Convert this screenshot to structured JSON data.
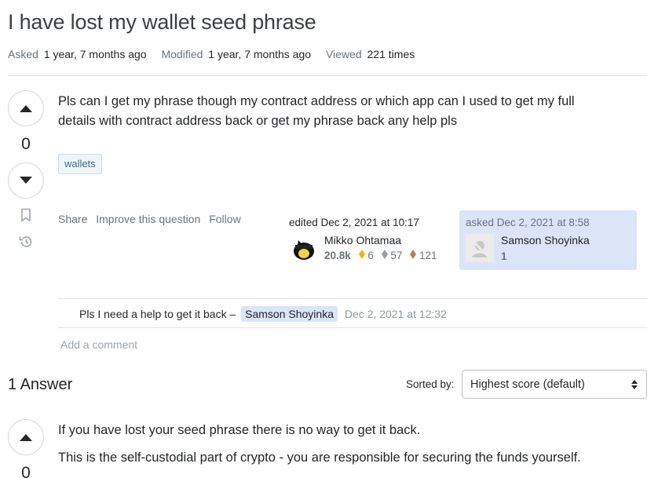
{
  "question": {
    "title": "I have lost my wallet seed phrase",
    "meta": {
      "asked_label": "Asked",
      "asked_value": "1 year, 7 months ago",
      "modified_label": "Modified",
      "modified_value": "1 year, 7 months ago",
      "viewed_label": "Viewed",
      "viewed_value": "221 times"
    },
    "score": "0",
    "body_line1": "Pls can I get my phrase though my contract address or which app can I used to get my full",
    "body_line2": "details with contract address back or get my phrase back any help pls",
    "tags": [
      "wallets"
    ],
    "menu": {
      "share": "Share",
      "improve": "Improve this question",
      "follow": "Follow"
    },
    "editor": {
      "action": "edited Dec 2, 2021 at 10:17",
      "name": "Mikko Ohtamaa",
      "rep": "20.8k",
      "gold": "6",
      "silver": "57",
      "bronze": "121"
    },
    "owner": {
      "action": "asked Dec 2, 2021 at 8:58",
      "name": "Samson Shoyinka",
      "rep": "1"
    },
    "comment": {
      "text": "Pls I need a help to get it back –",
      "user": "Samson Shoyinka",
      "date": "Dec 2, 2021 at 12:32"
    },
    "add_comment": "Add a comment"
  },
  "answers": {
    "count_label": "1 Answer",
    "sorted_label": "Sorted by:",
    "sort_value": "Highest score (default)",
    "first": {
      "score": "0",
      "para1": "If you have lost your seed phrase there is no way to get it back.",
      "para2": "This is the self-custodial part of crypto - you are responsible for securing the funds yourself."
    }
  },
  "icons": {
    "upvote": "triangle-up-icon",
    "downvote": "triangle-down-icon",
    "bookmark": "bookmark-icon",
    "history": "history-icon",
    "gold": "gold-badge-icon",
    "silver": "silver-badge-icon",
    "bronze": "bronze-badge-icon",
    "sort_caret": "sort-caret-icon"
  },
  "colors": {
    "gold": "#f1b600",
    "silver": "#9a9c9f",
    "bronze": "#ab825f",
    "owner_bg": "#dce4f7",
    "tag_bg": "#eef6f8"
  }
}
